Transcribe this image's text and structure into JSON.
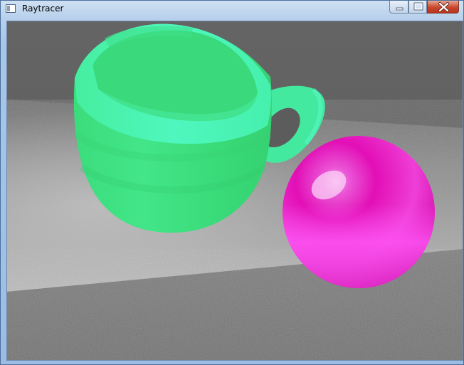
{
  "window": {
    "title": "Raytracer",
    "icons": {
      "app": "application-icon",
      "minimize": "minimize-icon",
      "maximize": "maximize-icon",
      "close": "close-icon"
    }
  },
  "scene": {
    "objects": [
      "cup",
      "sphere",
      "floor",
      "back-wall"
    ],
    "colors": {
      "cup": "#3ee07e",
      "cup_highlight": "#4cf3b6",
      "sphere": "#e60eb6",
      "sphere_highlight": "#fb4af0",
      "floor": "#a8a8a8",
      "wall": "#686868"
    }
  }
}
